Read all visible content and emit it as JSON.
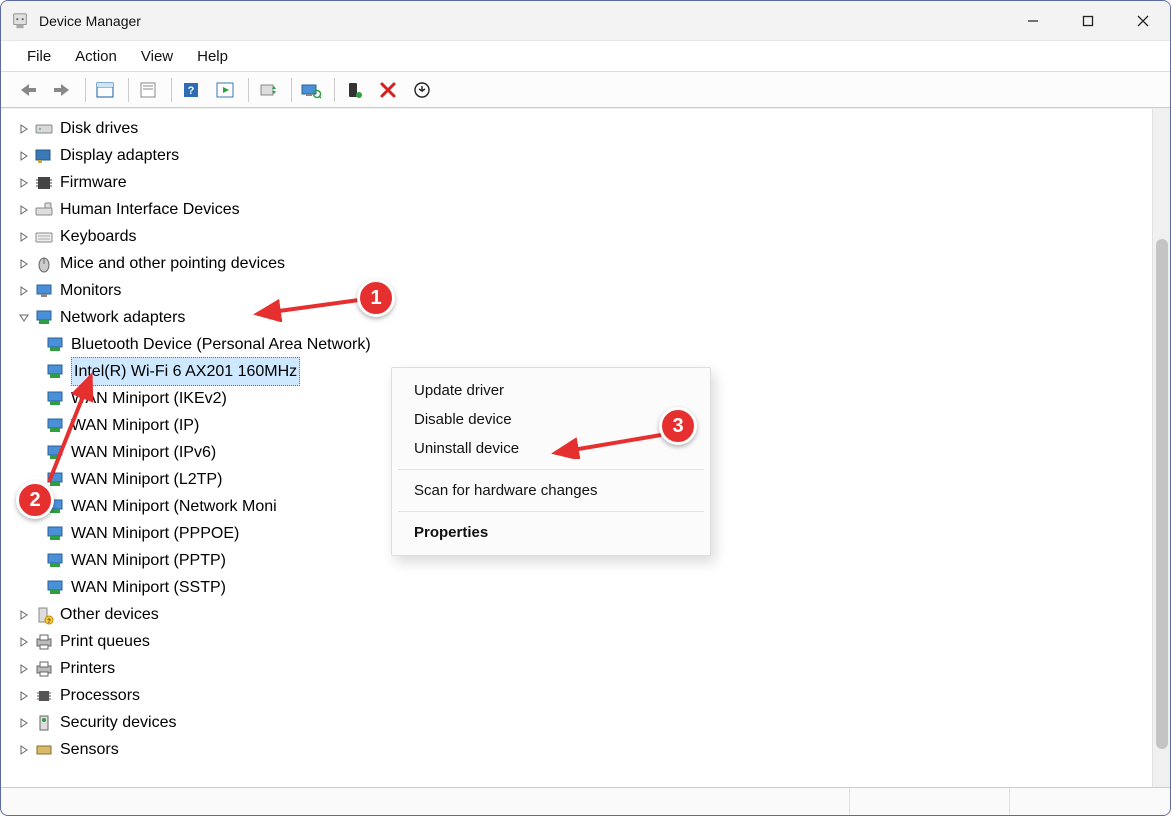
{
  "window": {
    "title": "Device Manager"
  },
  "menus": {
    "file": "File",
    "action": "Action",
    "view": "View",
    "help": "Help"
  },
  "tree": {
    "collapsed": [
      {
        "label": "Disk drives"
      },
      {
        "label": "Display adapters"
      },
      {
        "label": "Firmware"
      },
      {
        "label": "Human Interface Devices"
      },
      {
        "label": "Keyboards"
      },
      {
        "label": "Mice and other pointing devices"
      },
      {
        "label": "Monitors"
      }
    ],
    "expanded": {
      "label": "Network adapters",
      "children": [
        {
          "label": "Bluetooth Device (Personal Area Network)"
        },
        {
          "label": "Intel(R) Wi-Fi 6 AX201 160MHz",
          "selected": true
        },
        {
          "label": "WAN Miniport (IKEv2)"
        },
        {
          "label": "WAN Miniport (IP)"
        },
        {
          "label": "WAN Miniport (IPv6)"
        },
        {
          "label": "WAN Miniport (L2TP)"
        },
        {
          "label": "WAN Miniport (Network Moni"
        },
        {
          "label": "WAN Miniport (PPPOE)"
        },
        {
          "label": "WAN Miniport (PPTP)"
        },
        {
          "label": "WAN Miniport (SSTP)"
        }
      ]
    },
    "after": [
      {
        "label": "Other devices",
        "warn": true
      },
      {
        "label": "Print queues"
      },
      {
        "label": "Printers"
      },
      {
        "label": "Processors"
      },
      {
        "label": "Security devices"
      },
      {
        "label": "Sensors"
      }
    ]
  },
  "context_menu": {
    "update": "Update driver",
    "disable": "Disable device",
    "uninstall": "Uninstall device",
    "scan": "Scan for hardware changes",
    "properties": "Properties"
  },
  "annotations": {
    "m1": "1",
    "m2": "2",
    "m3": "3"
  }
}
